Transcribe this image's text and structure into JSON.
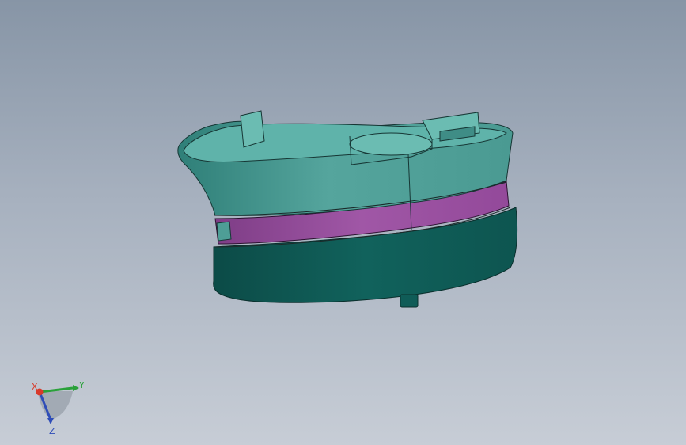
{
  "viewport": {
    "background_top": "#8795a6",
    "background_bottom": "#c7cdd6"
  },
  "model": {
    "top_shell_color": "#4e9e96",
    "rim_color": "#5fb3aa",
    "band_color": "#9a4fa0",
    "base_color": "#0f5c57",
    "edge_color": "#1b2a2a"
  },
  "triad": {
    "x_label": "X",
    "y_label": "Y",
    "z_label": "Z",
    "x_color": "#d83a2a",
    "y_color": "#2aa13a",
    "z_color": "#2f4db8"
  }
}
